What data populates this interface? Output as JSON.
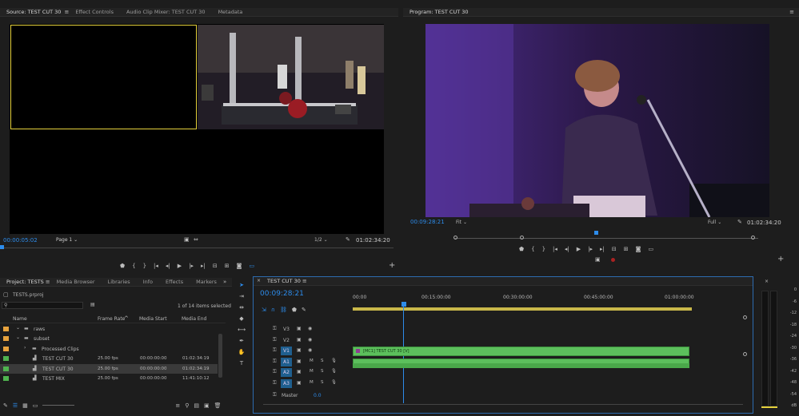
{
  "source": {
    "tabs": [
      "Source: TEST CUT 30",
      "Effect Controls",
      "Audio Clip Mixer: TEST CUT 30",
      "Metadata"
    ],
    "timecode": "00:00:05:02",
    "page": "Page 1",
    "fraction": "1/2",
    "duration": "01:02:34:20"
  },
  "program": {
    "title": "Program: TEST CUT 30",
    "timecode": "00:09:28:21",
    "fit": "Fit",
    "quality": "Full",
    "duration": "01:02:34:20"
  },
  "project": {
    "tabs": [
      "Project: TESTS",
      "Media Browser",
      "Libraries",
      "Info",
      "Effects",
      "Markers"
    ],
    "file": "TESTS.prproj",
    "selection": "1 of 14 items selected",
    "columns": [
      "Name",
      "Frame Rate",
      "Media Start",
      "Media End"
    ],
    "rows": [
      {
        "name": "raws",
        "fr": "",
        "ms": "",
        "me": "",
        "color": "#e8a33d",
        "kind": "folder",
        "indent": 1
      },
      {
        "name": "subset",
        "fr": "",
        "ms": "",
        "me": "",
        "color": "#e8a33d",
        "kind": "folder",
        "indent": 1
      },
      {
        "name": "Processed Clips",
        "fr": "",
        "ms": "",
        "me": "",
        "color": "#e8a33d",
        "kind": "folder",
        "indent": 2
      },
      {
        "name": "TEST CUT 30",
        "fr": "25.00 fps",
        "ms": "00:00:00:00",
        "me": "01:02:34:19",
        "color": "#4fb34f",
        "kind": "seq",
        "indent": 2
      },
      {
        "name": "TEST CUT 30",
        "fr": "25.00 fps",
        "ms": "00:00:00:00",
        "me": "01:02:34:19",
        "color": "#4fb34f",
        "kind": "seq",
        "indent": 2
      },
      {
        "name": "TEST MIX",
        "fr": "25.00 fps",
        "ms": "00:00:00:00",
        "me": "11:41:10:12",
        "color": "#4fb34f",
        "kind": "seq",
        "indent": 2
      }
    ]
  },
  "timeline": {
    "tab": "TEST CUT 30",
    "timecode": "00:09:28:21",
    "ruler": [
      "00:00",
      "00:15:00:00",
      "00:30:00:00",
      "00:45:00:00",
      "01:00:00:00"
    ],
    "tracks": [
      "V3",
      "V2",
      "V1",
      "A1",
      "A2",
      "A3"
    ],
    "master_label": "Master",
    "master_value": "0.0",
    "clip_label": "[MC1] TEST CUT 30 [V]",
    "clip_color": "#5cbf5c"
  },
  "meter": {
    "scale": [
      "0",
      "-6",
      "-12",
      "-18",
      "-24",
      "-30",
      "-36",
      "-42",
      "-48",
      "-54",
      "dB"
    ]
  },
  "colors": {
    "accent": "#2d8ceb",
    "label_yellow": "#e5d13c"
  }
}
